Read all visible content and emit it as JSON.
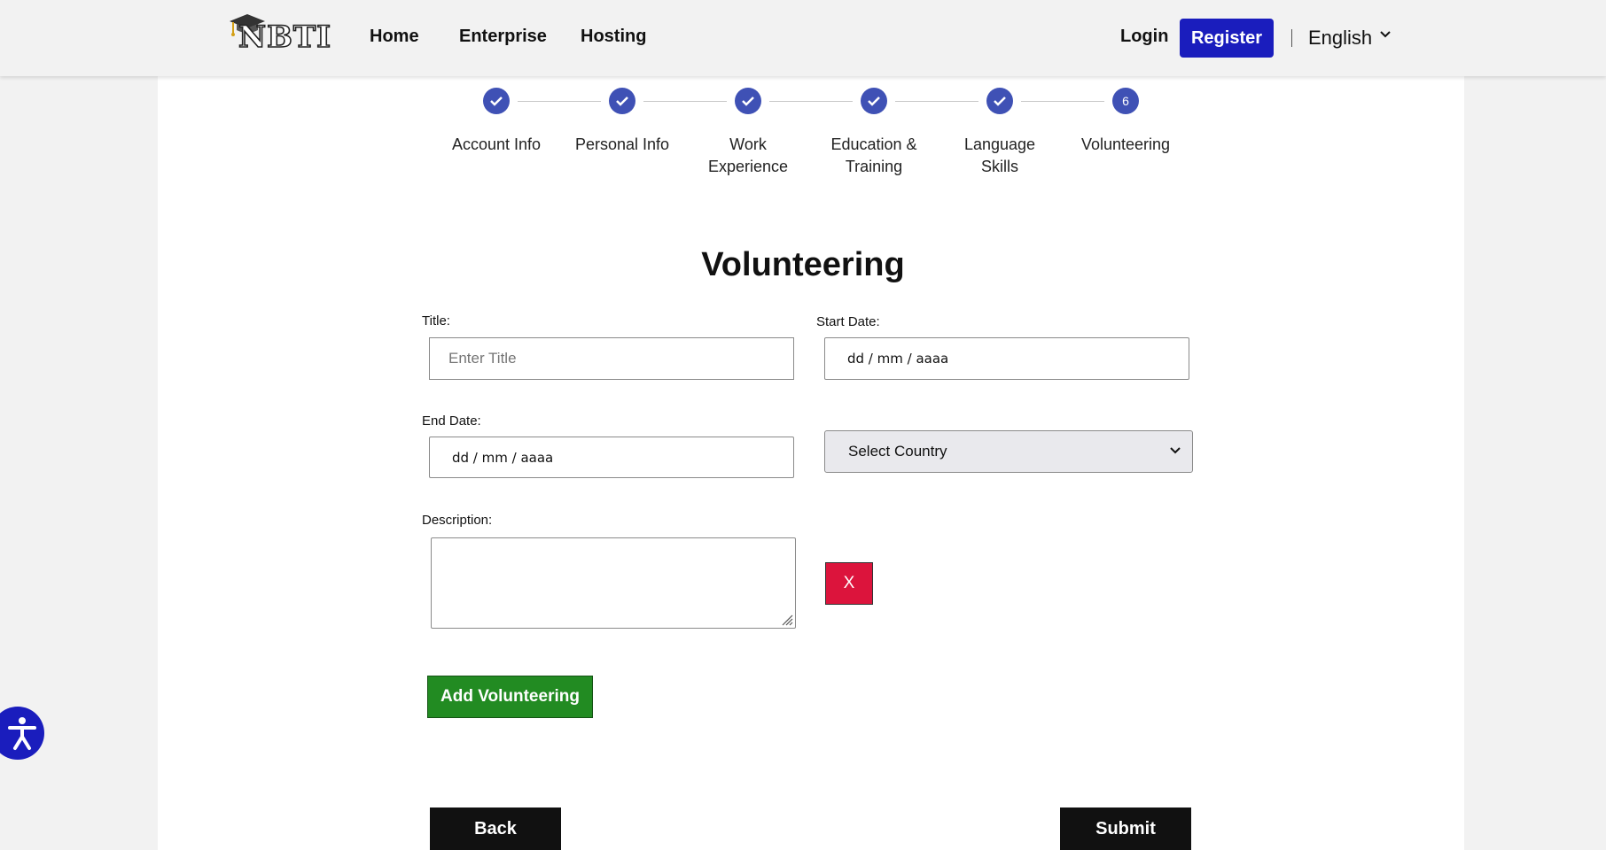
{
  "header": {
    "logo_text": "NBTI",
    "nav": [
      {
        "label": "Home"
      },
      {
        "label": "Enterprise"
      },
      {
        "label": "Hosting"
      }
    ],
    "login_label": "Login",
    "register_label": "Register",
    "language": "English",
    "accent_color": "#1a1dbd"
  },
  "stepper": {
    "steps": [
      {
        "label": "Account Info",
        "status": "completed"
      },
      {
        "label": "Personal Info",
        "status": "completed"
      },
      {
        "label": "Work Experience",
        "status": "completed"
      },
      {
        "label": "Education & Training",
        "status": "completed"
      },
      {
        "label": "Language Skills",
        "status": "completed"
      },
      {
        "label": "Volunteering",
        "status": "current",
        "number": "6"
      }
    ],
    "color": "#3f51b5"
  },
  "form": {
    "title": "Volunteering",
    "title_label": "Title:",
    "title_placeholder": "Enter Title",
    "start_label": "Start Date:",
    "start_value": "dd / mm / aaaa",
    "end_label": "End Date:",
    "end_value": "dd / mm / aaaa",
    "country_selected": "Select Country",
    "description_label": "Description:",
    "description_value": "",
    "remove_label": "X",
    "remove_color": "#dc143c",
    "add_label": "Add Volunteering",
    "add_color": "#228b22"
  },
  "footer_actions": {
    "back_label": "Back",
    "submit_label": "Submit"
  },
  "accessibility": {
    "icon": "accessibility-icon"
  }
}
